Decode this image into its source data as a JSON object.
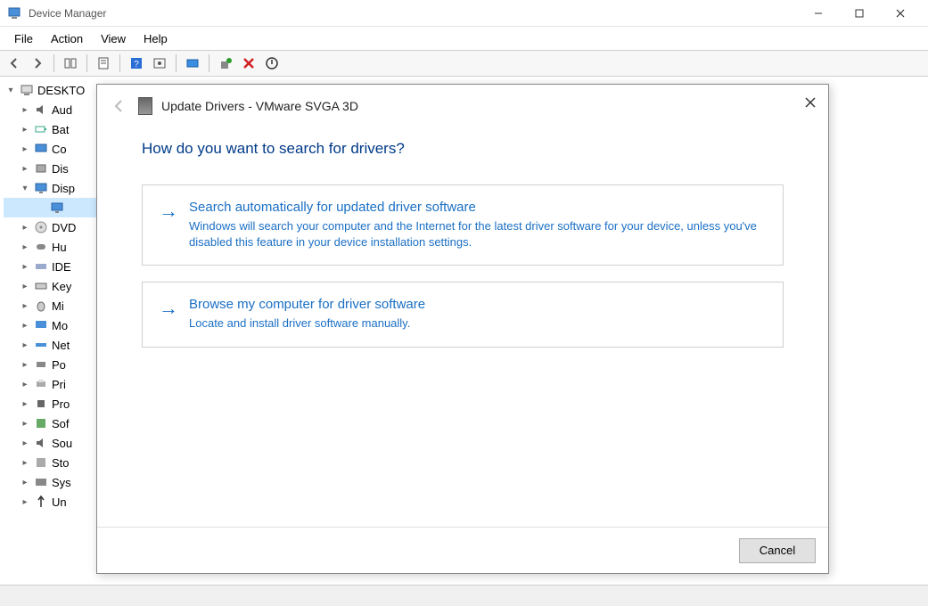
{
  "window": {
    "title": "Device Manager"
  },
  "menubar": {
    "file": "File",
    "action": "Action",
    "view": "View",
    "help": "Help"
  },
  "tree": {
    "root": "DESKTO",
    "items": [
      {
        "label": "Aud",
        "kind": "audio"
      },
      {
        "label": "Bat",
        "kind": "battery"
      },
      {
        "label": "Co",
        "kind": "computer"
      },
      {
        "label": "Dis",
        "kind": "disk"
      },
      {
        "label": "Disp",
        "kind": "display",
        "expanded": true
      },
      {
        "label": "DVD",
        "kind": "dvd"
      },
      {
        "label": "Hu",
        "kind": "hid"
      },
      {
        "label": "IDE",
        "kind": "ide"
      },
      {
        "label": "Key",
        "kind": "keyboard"
      },
      {
        "label": "Mi",
        "kind": "mice"
      },
      {
        "label": "Mo",
        "kind": "monitor"
      },
      {
        "label": "Net",
        "kind": "network"
      },
      {
        "label": "Po",
        "kind": "ports"
      },
      {
        "label": "Pri",
        "kind": "print"
      },
      {
        "label": "Pro",
        "kind": "processor"
      },
      {
        "label": "Sof",
        "kind": "software"
      },
      {
        "label": "Sou",
        "kind": "sound"
      },
      {
        "label": "Sto",
        "kind": "storage"
      },
      {
        "label": "Sys",
        "kind": "system"
      },
      {
        "label": "Un",
        "kind": "usb"
      }
    ]
  },
  "dialog": {
    "title": "Update Drivers - VMware SVGA 3D",
    "heading": "How do you want to search for drivers?",
    "options": [
      {
        "title": "Search automatically for updated driver software",
        "desc": "Windows will search your computer and the Internet for the latest driver software for your device, unless you've disabled this feature in your device installation settings."
      },
      {
        "title": "Browse my computer for driver software",
        "desc": "Locate and install driver software manually."
      }
    ],
    "cancel": "Cancel"
  }
}
